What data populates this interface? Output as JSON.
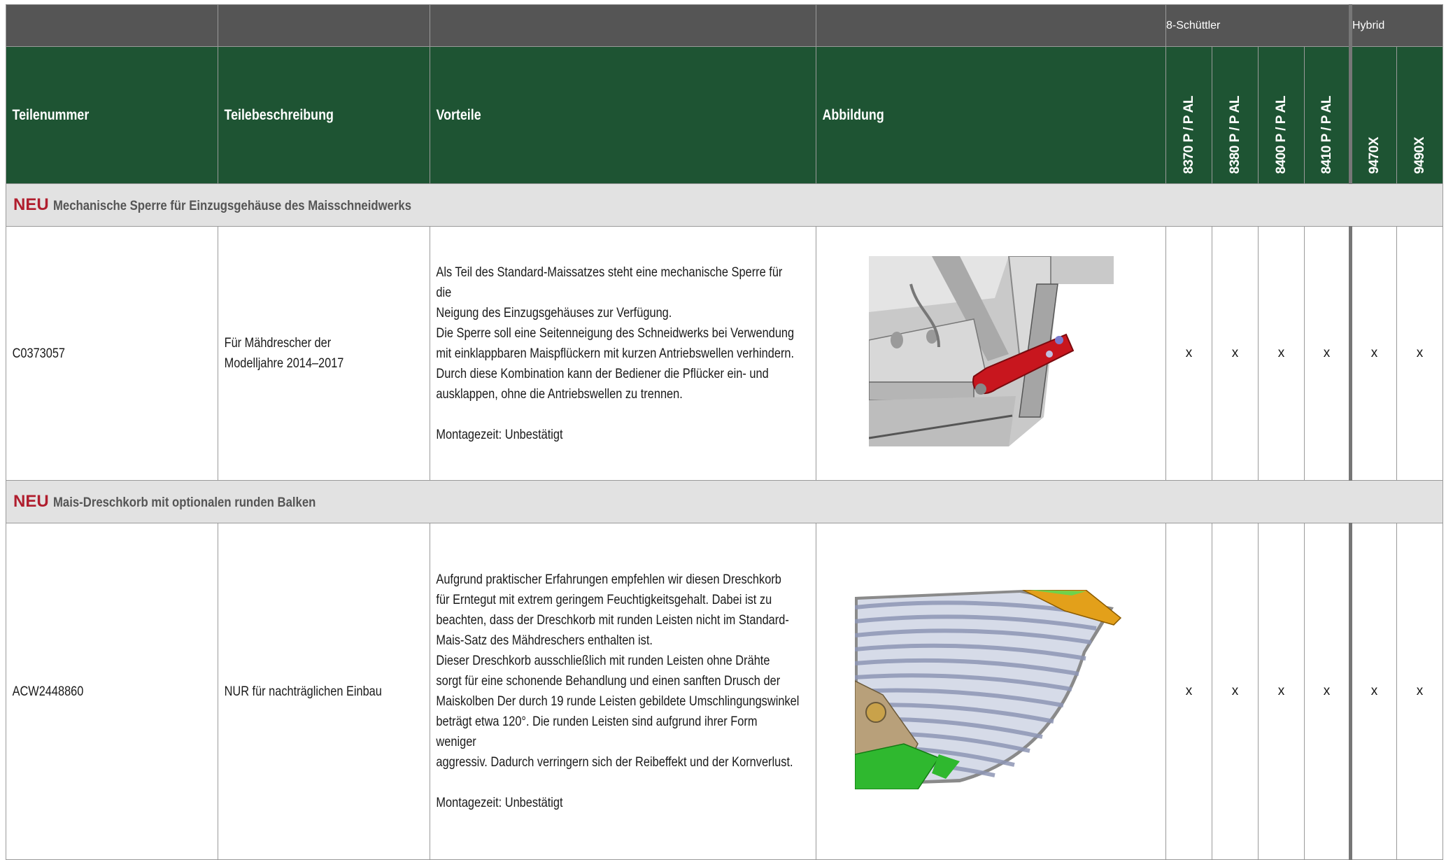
{
  "groups": {
    "schuettler": "8-Schüttler",
    "hybrid": "Hybrid"
  },
  "columns": {
    "part_number": "Teilenummer",
    "description": "Teilebeschreibung",
    "advantages": "Vorteile",
    "illustration": "Abbildung"
  },
  "models": [
    "8370 P / P AL",
    "8380 P / P AL",
    "8400 P / P AL",
    "8410 P / P AL",
    "9470X",
    "9490X"
  ],
  "sections": [
    {
      "badge": "NEU",
      "title": "Mechanische Sperre für Einzugsgehäuse des Maisschneidwerks",
      "part_number": "C0373057",
      "description": "Für Mähdrescher der\nModelljahre 2014–2017",
      "advantages": "Als Teil des Standard-Maissatzes steht eine mechanische Sperre für die\nNeigung des Einzugsgehäuses zur Verfügung.\nDie Sperre soll eine Seitenneigung des Schneidwerks bei Verwendung\nmit einklappbaren Maispflückern mit kurzen Antriebswellen verhindern.\nDurch diese Kombination kann der Bediener die Pflücker ein- und\nausklappen, ohne die Antriebswellen zu trennen.\n\nMontagezeit: Unbestätigt",
      "marks": [
        "x",
        "x",
        "x",
        "x",
        "x",
        "x"
      ]
    },
    {
      "badge": "NEU",
      "title": "Mais-Dreschkorb mit optionalen runden Balken",
      "part_number": "ACW2448860",
      "description": "NUR für nachträglichen Einbau",
      "advantages": "Aufgrund praktischer Erfahrungen empfehlen wir diesen Dreschkorb\nfür Erntegut mit extrem geringem Feuchtigkeitsgehalt. Dabei ist zu\nbeachten, dass der Dreschkorb mit runden Leisten nicht im Standard-\nMais-Satz des Mähdreschers enthalten ist.\nDieser Dreschkorb ausschließlich mit runden Leisten ohne Drähte\nsorgt für eine schonende Behandlung und einen sanften Drusch der\nMaiskolben Der durch 19 runde Leisten gebildete Umschlingungswinkel\nbeträgt etwa 120°. Die runden Leisten sind aufgrund ihrer Form weniger\naggressiv. Dadurch verringern sich der Reibeffekt und der Kornverlust.\n\nMontagezeit: Unbestätigt",
      "marks": [
        "x",
        "x",
        "x",
        "x",
        "x",
        "x"
      ]
    }
  ]
}
